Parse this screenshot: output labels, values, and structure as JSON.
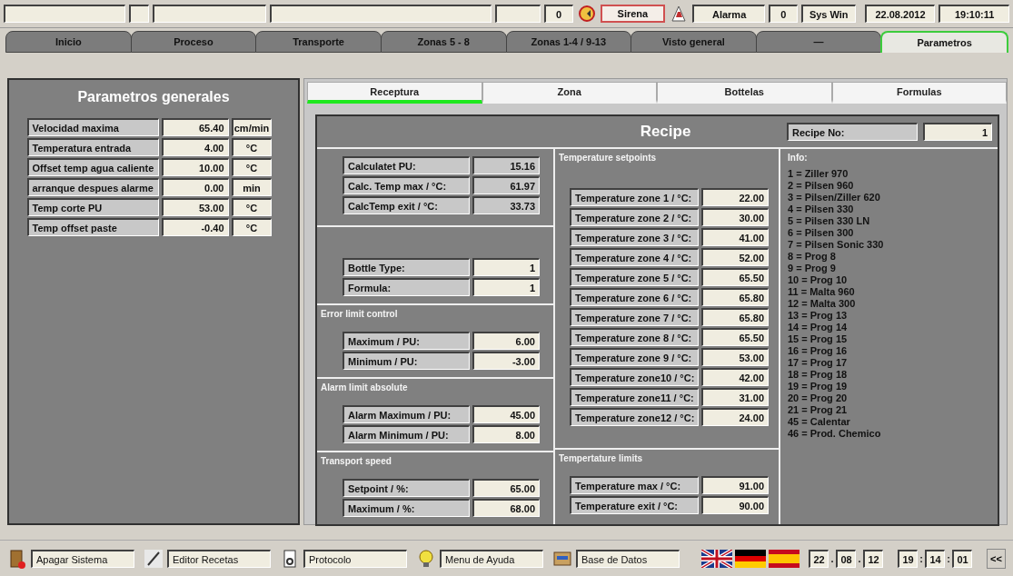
{
  "top_bar": {
    "alarm_count": "0",
    "siren_label": "Sirena",
    "alarm_label": "Alarma",
    "sys_count": "0",
    "sys_label": "Sys Win",
    "date": "22.08.2012",
    "time": "19:10:11"
  },
  "tabs": [
    {
      "label": "Inicio",
      "selected": false
    },
    {
      "label": "Proceso",
      "selected": false
    },
    {
      "label": "Transporte",
      "selected": false
    },
    {
      "label": "Zonas 5 - 8",
      "selected": false
    },
    {
      "label": "Zonas 1-4 / 9-13",
      "selected": false
    },
    {
      "label": "Visto general",
      "selected": false
    },
    {
      "label": "—",
      "selected": false
    },
    {
      "label": "Parametros",
      "selected": true
    }
  ],
  "general_parameters": {
    "title": "Parametros generales",
    "rows": [
      {
        "label": "Velocidad maxima",
        "value": "65.40",
        "unit": "cm/min"
      },
      {
        "label": "Temperatura entrada",
        "value": "4.00",
        "unit": "°C"
      },
      {
        "label": "Offset temp agua caliente",
        "value": "10.00",
        "unit": "°C"
      },
      {
        "label": "arranque despues alarme",
        "value": "0.00",
        "unit": "min"
      },
      {
        "label": "Temp corte PU",
        "value": "53.00",
        "unit": "°C"
      },
      {
        "label": "Temp offset paste",
        "value": "-0.40",
        "unit": "°C"
      }
    ]
  },
  "subtabs": [
    {
      "label": "Receptura",
      "selected": true
    },
    {
      "label": "Zona",
      "selected": false
    },
    {
      "label": "Bottelas",
      "selected": false
    },
    {
      "label": "Formulas",
      "selected": false
    }
  ],
  "recipe": {
    "title": "Recipe",
    "recipe_no": {
      "label": "Recipe No:",
      "value": "1"
    },
    "left_column": [
      {
        "rows": [
          {
            "label": "Calculatet PU:",
            "value": "15.16",
            "editable": false
          },
          {
            "label": "Calc. Temp max / °C:",
            "value": "61.97",
            "editable": false
          },
          {
            "label": "CalcTemp exit / °C:",
            "value": "33.73",
            "editable": false
          }
        ]
      },
      {
        "rows": [
          {
            "label": "Bottle Type:",
            "value": "1",
            "editable": true
          },
          {
            "label": "Formula:",
            "value": "1",
            "editable": true
          }
        ]
      },
      {
        "title": "Error limit control",
        "rows": [
          {
            "label": "Maximum / PU:",
            "value": "6.00",
            "editable": true
          },
          {
            "label": "Minimum / PU:",
            "value": "-3.00",
            "editable": true
          }
        ]
      },
      {
        "title": "Alarm limit absolute",
        "rows": [
          {
            "label": "Alarm Maximum / PU:",
            "value": "45.00",
            "editable": true
          },
          {
            "label": "Alarm Minimum / PU:",
            "value": "8.00",
            "editable": true
          }
        ]
      },
      {
        "title": "Transport speed",
        "rows": [
          {
            "label": "Setpoint / %:",
            "value": "65.00",
            "editable": true
          },
          {
            "label": "Maximum / %:",
            "value": "68.00",
            "editable": true
          }
        ]
      }
    ],
    "middle_column": [
      {
        "title": "Temperature setpoints",
        "rows": [
          {
            "label": "Temperature zone 1 / °C:",
            "value": "22.00",
            "editable": true
          },
          {
            "label": "Temperature zone 2 / °C:",
            "value": "30.00",
            "editable": true
          },
          {
            "label": "Temperature zone 3 / °C:",
            "value": "41.00",
            "editable": true
          },
          {
            "label": "Temperature zone 4 / °C:",
            "value": "52.00",
            "editable": true
          },
          {
            "label": "Temperature zone 5 / °C:",
            "value": "65.50",
            "editable": true
          },
          {
            "label": "Temperature zone 6 / °C:",
            "value": "65.80",
            "editable": true
          },
          {
            "label": "Temperature zone 7 / °C:",
            "value": "65.80",
            "editable": true
          },
          {
            "label": "Temperature zone 8 / °C:",
            "value": "65.50",
            "editable": true
          },
          {
            "label": "Temperature zone 9 / °C:",
            "value": "53.00",
            "editable": true
          },
          {
            "label": "Temperature zone10 / °C:",
            "value": "42.00",
            "editable": true
          },
          {
            "label": "Temperature zone11 / °C:",
            "value": "31.00",
            "editable": true
          },
          {
            "label": "Temperature zone12 / °C:",
            "value": "24.00",
            "editable": true
          }
        ]
      },
      {
        "title": "Tempertature limits",
        "rows": [
          {
            "label": "Temperature max / °C:",
            "value": "91.00",
            "editable": true
          },
          {
            "label": "Temperature exit / °C:",
            "value": "90.00",
            "editable": true
          }
        ]
      }
    ],
    "info": {
      "title": "Info:",
      "lines": [
        "1 = Ziller 970",
        "2 = Pilsen 960",
        "3 = Pilsen/Ziller 620",
        "4 = Pilsen 330",
        "5 = Pilsen 330 LN",
        "6 = Pilsen 300",
        "7 = Pilsen Sonic 330",
        "8 = Prog 8",
        "9 = Prog 9",
        "10 = Prog 10",
        "11 = Malta 960",
        "12 = Malta 300",
        "13 = Prog 13",
        "14 = Prog 14",
        "15 = Prog 15",
        "16 = Prog 16",
        "17 = Prog 17",
        "18 = Prog 18",
        "19 = Prog 19",
        "20 = Prog 20",
        "21 = Prog 21",
        "45 = Calentar",
        "46 = Prod. Chemico"
      ]
    }
  },
  "taskbar": {
    "buttons": [
      {
        "kind": "exit",
        "label": "Apagar Sistema"
      },
      {
        "kind": "edit",
        "label": "Editor Recetas"
      },
      {
        "kind": "print",
        "label": "Protocolo"
      },
      {
        "kind": "help",
        "label": "Menu de Ayuda"
      },
      {
        "kind": "database",
        "label": "Base de Datos"
      }
    ],
    "flags": [
      {
        "kind": "uk"
      },
      {
        "kind": "de"
      },
      {
        "kind": "es"
      }
    ],
    "date": [
      {
        "kind": "field",
        "text": "22"
      },
      {
        "kind": "sep",
        "text": "."
      },
      {
        "kind": "field",
        "text": "08"
      },
      {
        "kind": "sep",
        "text": "."
      },
      {
        "kind": "field",
        "text": "12"
      }
    ],
    "time": [
      {
        "kind": "field",
        "text": "19"
      },
      {
        "kind": "sep",
        "text": ":"
      },
      {
        "kind": "field",
        "text": "14"
      },
      {
        "kind": "sep",
        "text": ":"
      },
      {
        "kind": "field",
        "text": "01"
      }
    ],
    "collapse": "<<"
  }
}
